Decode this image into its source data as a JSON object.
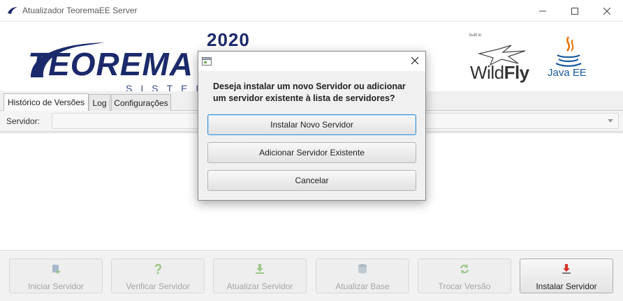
{
  "window": {
    "title": "Atualizador TeoremaEE Server"
  },
  "header": {
    "year": "2020",
    "brand_name": "TEOREMA",
    "brand_sub": "SISTEMAS",
    "wildfly_builtin": "built in",
    "wildfly_name_light": "Wild",
    "wildfly_name_bold": "Fly",
    "javaee_name": "Java EE"
  },
  "tabs": [
    {
      "label": "Histórico de Versões",
      "active": true
    },
    {
      "label": "Log",
      "active": false
    },
    {
      "label": "Configurações",
      "active": false
    }
  ],
  "server": {
    "label": "Servidor:",
    "selected_value": ""
  },
  "toolbar": [
    {
      "label": "Iniciar Servidor",
      "icon": "server-start-icon",
      "enabled": false
    },
    {
      "label": "Verificar Servidor",
      "icon": "question-icon",
      "enabled": false
    },
    {
      "label": "Atualizar Servidor",
      "icon": "download-arrow-icon",
      "enabled": false
    },
    {
      "label": "Atualizar Base",
      "icon": "database-icon",
      "enabled": false
    },
    {
      "label": "Trocar Versão",
      "icon": "refresh-icon",
      "enabled": false
    },
    {
      "label": "Instalar Servidor",
      "icon": "install-icon",
      "enabled": true
    }
  ],
  "dialog": {
    "message": "Deseja instalar um novo Servidor ou adicionar um servidor existente à lista de servidores?",
    "buttons": {
      "install_new": "Instalar Novo Servidor",
      "add_existing": "Adicionar Servidor Existente",
      "cancel": "Cancelar"
    }
  },
  "colors": {
    "brand_navy": "#1b2a6b",
    "java_blue": "#1a5aa0",
    "java_orange": "#e76f00",
    "install_red": "#d9312b",
    "focus_blue": "#3b8fd6"
  }
}
